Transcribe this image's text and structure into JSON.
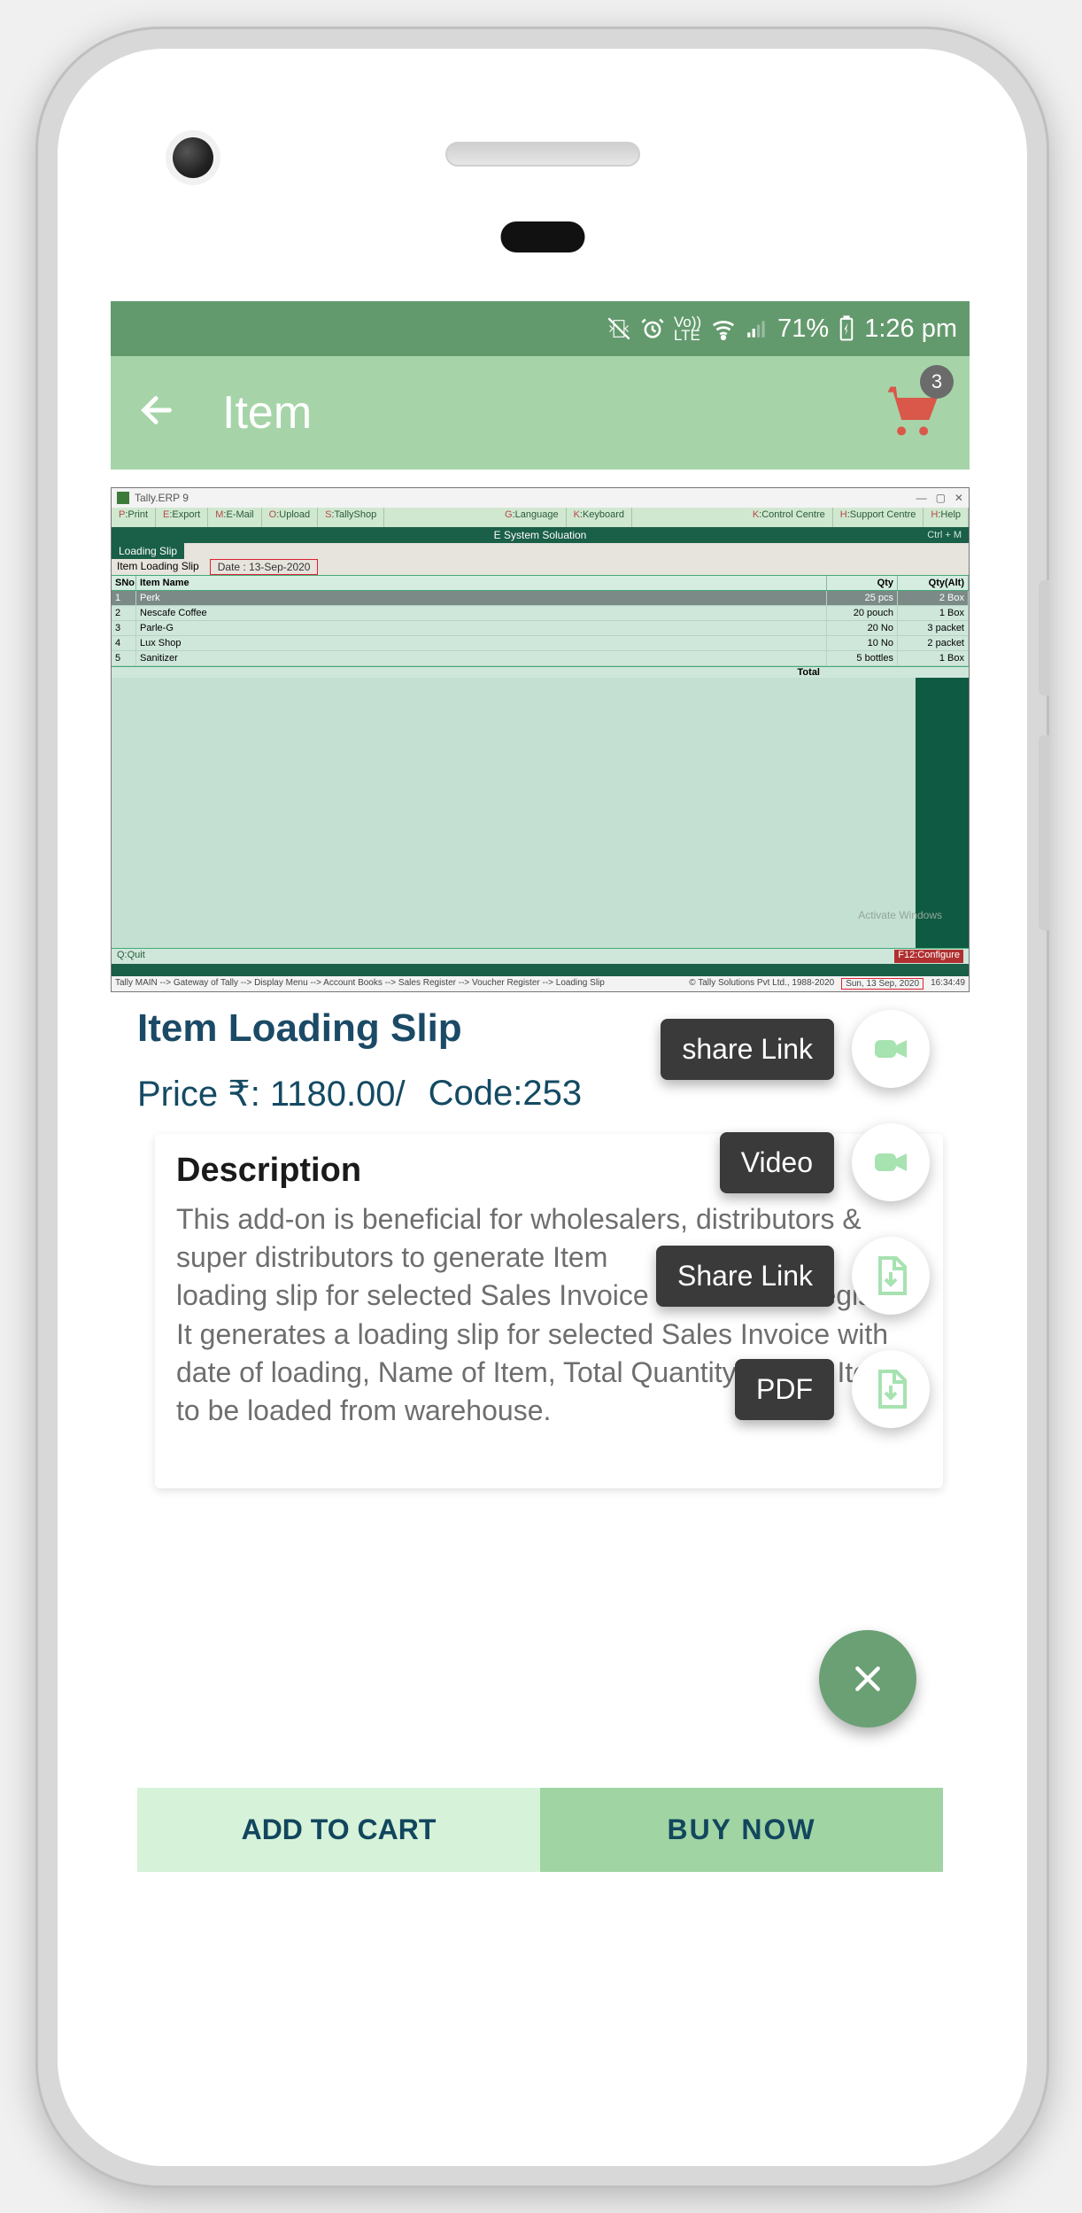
{
  "status": {
    "battery": "71%",
    "time": "1:26 pm"
  },
  "appbar": {
    "title": "Item",
    "cart_count": "3"
  },
  "tally": {
    "window_title": "Tally.ERP 9",
    "menu": [
      "P:Print",
      "E:Export",
      "M:E-Mail",
      "O:Upload",
      "S:TallyShop",
      "G:Language",
      "K:Keyboard",
      "K:Control Centre",
      "H:Support Centre",
      "H:Help"
    ],
    "company": "E System Soluation",
    "ctrl": "Ctrl + M",
    "section": "Loading Slip",
    "sub": "Item Loading Slip",
    "date": "Date : 13-Sep-2020",
    "cols": [
      "SNo",
      "Item Name",
      "Qty",
      "Qty(Alt)"
    ],
    "rows": [
      {
        "sn": "1",
        "name": "Perk",
        "qty": "25 pcs",
        "alt": "2 Box"
      },
      {
        "sn": "2",
        "name": "Nescafe Coffee",
        "qty": "20 pouch",
        "alt": "1 Box"
      },
      {
        "sn": "3",
        "name": "Parle-G",
        "qty": "20 No",
        "alt": "3 packet"
      },
      {
        "sn": "4",
        "name": "Lux Shop",
        "qty": "10 No",
        "alt": "2 packet"
      },
      {
        "sn": "5",
        "name": "Sanitizer",
        "qty": "5 bottles",
        "alt": "1 Box"
      }
    ],
    "total": "Total",
    "quit": "Q:Quit",
    "configure": "F12:Configure",
    "watermark": "Activate Windows",
    "breadcrumb": "Tally MAIN --> Gateway of Tally --> Display Menu --> Account Books --> Sales Register --> Voucher Register --> Loading Slip",
    "copyright": "© Tally Solutions Pvt Ltd., 1988-2020",
    "footer_date": "Sun, 13 Sep, 2020",
    "footer_time": "16:34:49"
  },
  "product": {
    "title": "Item Loading Slip",
    "price_label": "Price ₹: 1180.00/",
    "code_label": "Code:253",
    "desc_label": "Description",
    "desc_body": "This add-on is beneficial for wholesalers, distributors & super distributors to generate Item\nloading slip for selected Sales Invoice from Sales Register.\nIt generates a loading slip for selected Sales Invoice with date of loading, Name of Item, Total Quantity for this Item to be loaded from warehouse."
  },
  "fab": {
    "video_share": "share Link",
    "video": "Video",
    "pdf_share": "Share Link",
    "pdf": "PDF"
  },
  "buttons": {
    "add": "ADD TO CART",
    "buy": "BUY  NOW"
  }
}
